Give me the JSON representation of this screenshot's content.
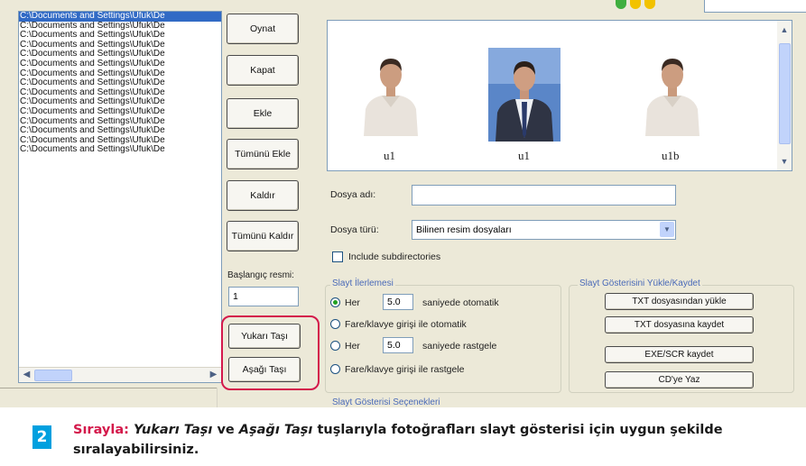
{
  "file_list": {
    "rows": [
      "C:\\Documents and Settings\\Ufuk\\De",
      "C:\\Documents and Settings\\Ufuk\\De",
      "C:\\Documents and Settings\\Ufuk\\De",
      "C:\\Documents and Settings\\Ufuk\\De",
      "C:\\Documents and Settings\\Ufuk\\De",
      "C:\\Documents and Settings\\Ufuk\\De",
      "C:\\Documents and Settings\\Ufuk\\De",
      "C:\\Documents and Settings\\Ufuk\\De",
      "C:\\Documents and Settings\\Ufuk\\De",
      "C:\\Documents and Settings\\Ufuk\\De",
      "C:\\Documents and Settings\\Ufuk\\De",
      "C:\\Documents and Settings\\Ufuk\\De",
      "C:\\Documents and Settings\\Ufuk\\De",
      "C:\\Documents and Settings\\Ufuk\\De",
      "C:\\Documents and Settings\\Ufuk\\De"
    ],
    "selected_index": 0
  },
  "buttons": {
    "oynat": "Oynat",
    "kapat": "Kapat",
    "ekle": "Ekle",
    "tumunu_ekle": "Tümünü Ekle",
    "kaldir": "Kaldır",
    "tumunu_kaldir": "Tümünü Kaldır",
    "yukari_tasi": "Yukarı Taşı",
    "asagi_tasi": "Aşağı Taşı"
  },
  "start_image": {
    "label": "Başlangıç resmi:",
    "value": "1"
  },
  "thumbnails": [
    {
      "caption": "u1"
    },
    {
      "caption": "u1"
    },
    {
      "caption": "u1b"
    }
  ],
  "file_name": {
    "label": "Dosya adı:",
    "value": ""
  },
  "file_type": {
    "label": "Dosya türü:",
    "value": "Bilinen resim dosyaları"
  },
  "include_subdirs": {
    "label": "Include subdirectories",
    "checked": false
  },
  "slide_interval": {
    "title": "Slayt İlerlemesi",
    "options": [
      {
        "prefix": "Her",
        "value": "5.0",
        "suffix": "saniyede otomatik",
        "selected": true
      },
      {
        "label": "Fare/klavye girişi ile otomatik",
        "selected": false
      },
      {
        "prefix": "Her",
        "value": "5.0",
        "suffix": "saniyede rastgele",
        "selected": false
      },
      {
        "label": "Fare/klavye girişi ile rastgele",
        "selected": false
      }
    ]
  },
  "slideshow_save": {
    "title": "Slayt Gösterisini Yükle/Kaydet",
    "buttons": [
      "TXT dosyasından yükle",
      "TXT dosyasına kaydet",
      "EXE/SCR kaydet",
      "CD'ye Yaz"
    ]
  },
  "slideshow_options": {
    "title": "Slayt Gösterisi Seçenekleri"
  },
  "caption": {
    "number": "2",
    "lead": "Sırayla:",
    "part1": "Yukarı Taşı",
    "mid": "ve",
    "part2": "Aşağı Taşı",
    "rest": "tuşlarıyla fotoğrafları slayt gösterisi için uygun şekilde sıralayabilirsiniz."
  },
  "colors": {
    "highlight": "#d4194b",
    "badge": "#00a0df",
    "selection": "#316ac5"
  }
}
